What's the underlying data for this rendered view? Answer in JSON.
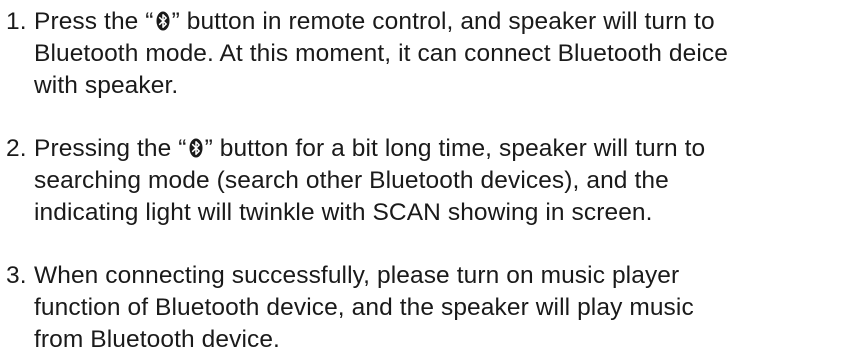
{
  "steps": [
    {
      "number": "1.",
      "line1_before_icon": "Press the “",
      "icon": "bluetooth-icon",
      "line1_after_icon": "” button in remote control, and speaker will turn to",
      "line2": "Bluetooth mode. At this moment, it can connect Bluetooth deice",
      "line3": "with speaker."
    },
    {
      "number": "2.",
      "line1_before_icon": "Pressing the “",
      "icon": "bluetooth-icon",
      "line1_after_icon": "” button for a bit long time, speaker will turn to",
      "line2": "searching mode (search other Bluetooth devices), and the",
      "line3": "indicating light will twinkle with SCAN showing in screen."
    },
    {
      "number": "3.",
      "line1": "When connecting successfully, please turn on music player",
      "line2": "function of  Bluetooth device, and the speaker will play music",
      "line3": "from Bluetooth device."
    }
  ]
}
